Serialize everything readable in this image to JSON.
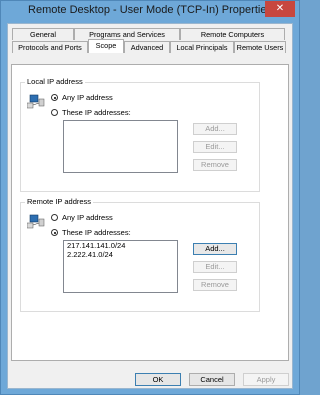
{
  "window": {
    "title": "Remote Desktop - User Mode (TCP-In) Properties",
    "close_glyph": "✕"
  },
  "tabs_row1": [
    {
      "label": "General"
    },
    {
      "label": "Programs and Services"
    },
    {
      "label": "Remote Computers"
    }
  ],
  "tabs_row2": [
    {
      "label": "Protocols and Ports"
    },
    {
      "label": "Scope"
    },
    {
      "label": "Advanced"
    },
    {
      "label": "Local Principals"
    },
    {
      "label": "Remote Users"
    }
  ],
  "local": {
    "group_label": "Local IP address",
    "option_any": "Any IP address",
    "option_these": "These IP addresses:",
    "selected": "any",
    "addresses": [],
    "add_label": "Add...",
    "edit_label": "Edit...",
    "remove_label": "Remove"
  },
  "remote": {
    "group_label": "Remote IP address",
    "option_any": "Any IP address",
    "option_these": "These IP addresses:",
    "selected": "these",
    "addresses": [
      "217.141.141.0/24",
      "2.222.41.0/24"
    ],
    "add_label": "Add...",
    "edit_label": "Edit...",
    "remove_label": "Remove"
  },
  "footer": {
    "ok": "OK",
    "cancel": "Cancel",
    "apply": "Apply"
  },
  "colors": {
    "title_bar": "#6ea8d8",
    "close_button": "#c7473f",
    "accent": "#3c7fb1"
  }
}
